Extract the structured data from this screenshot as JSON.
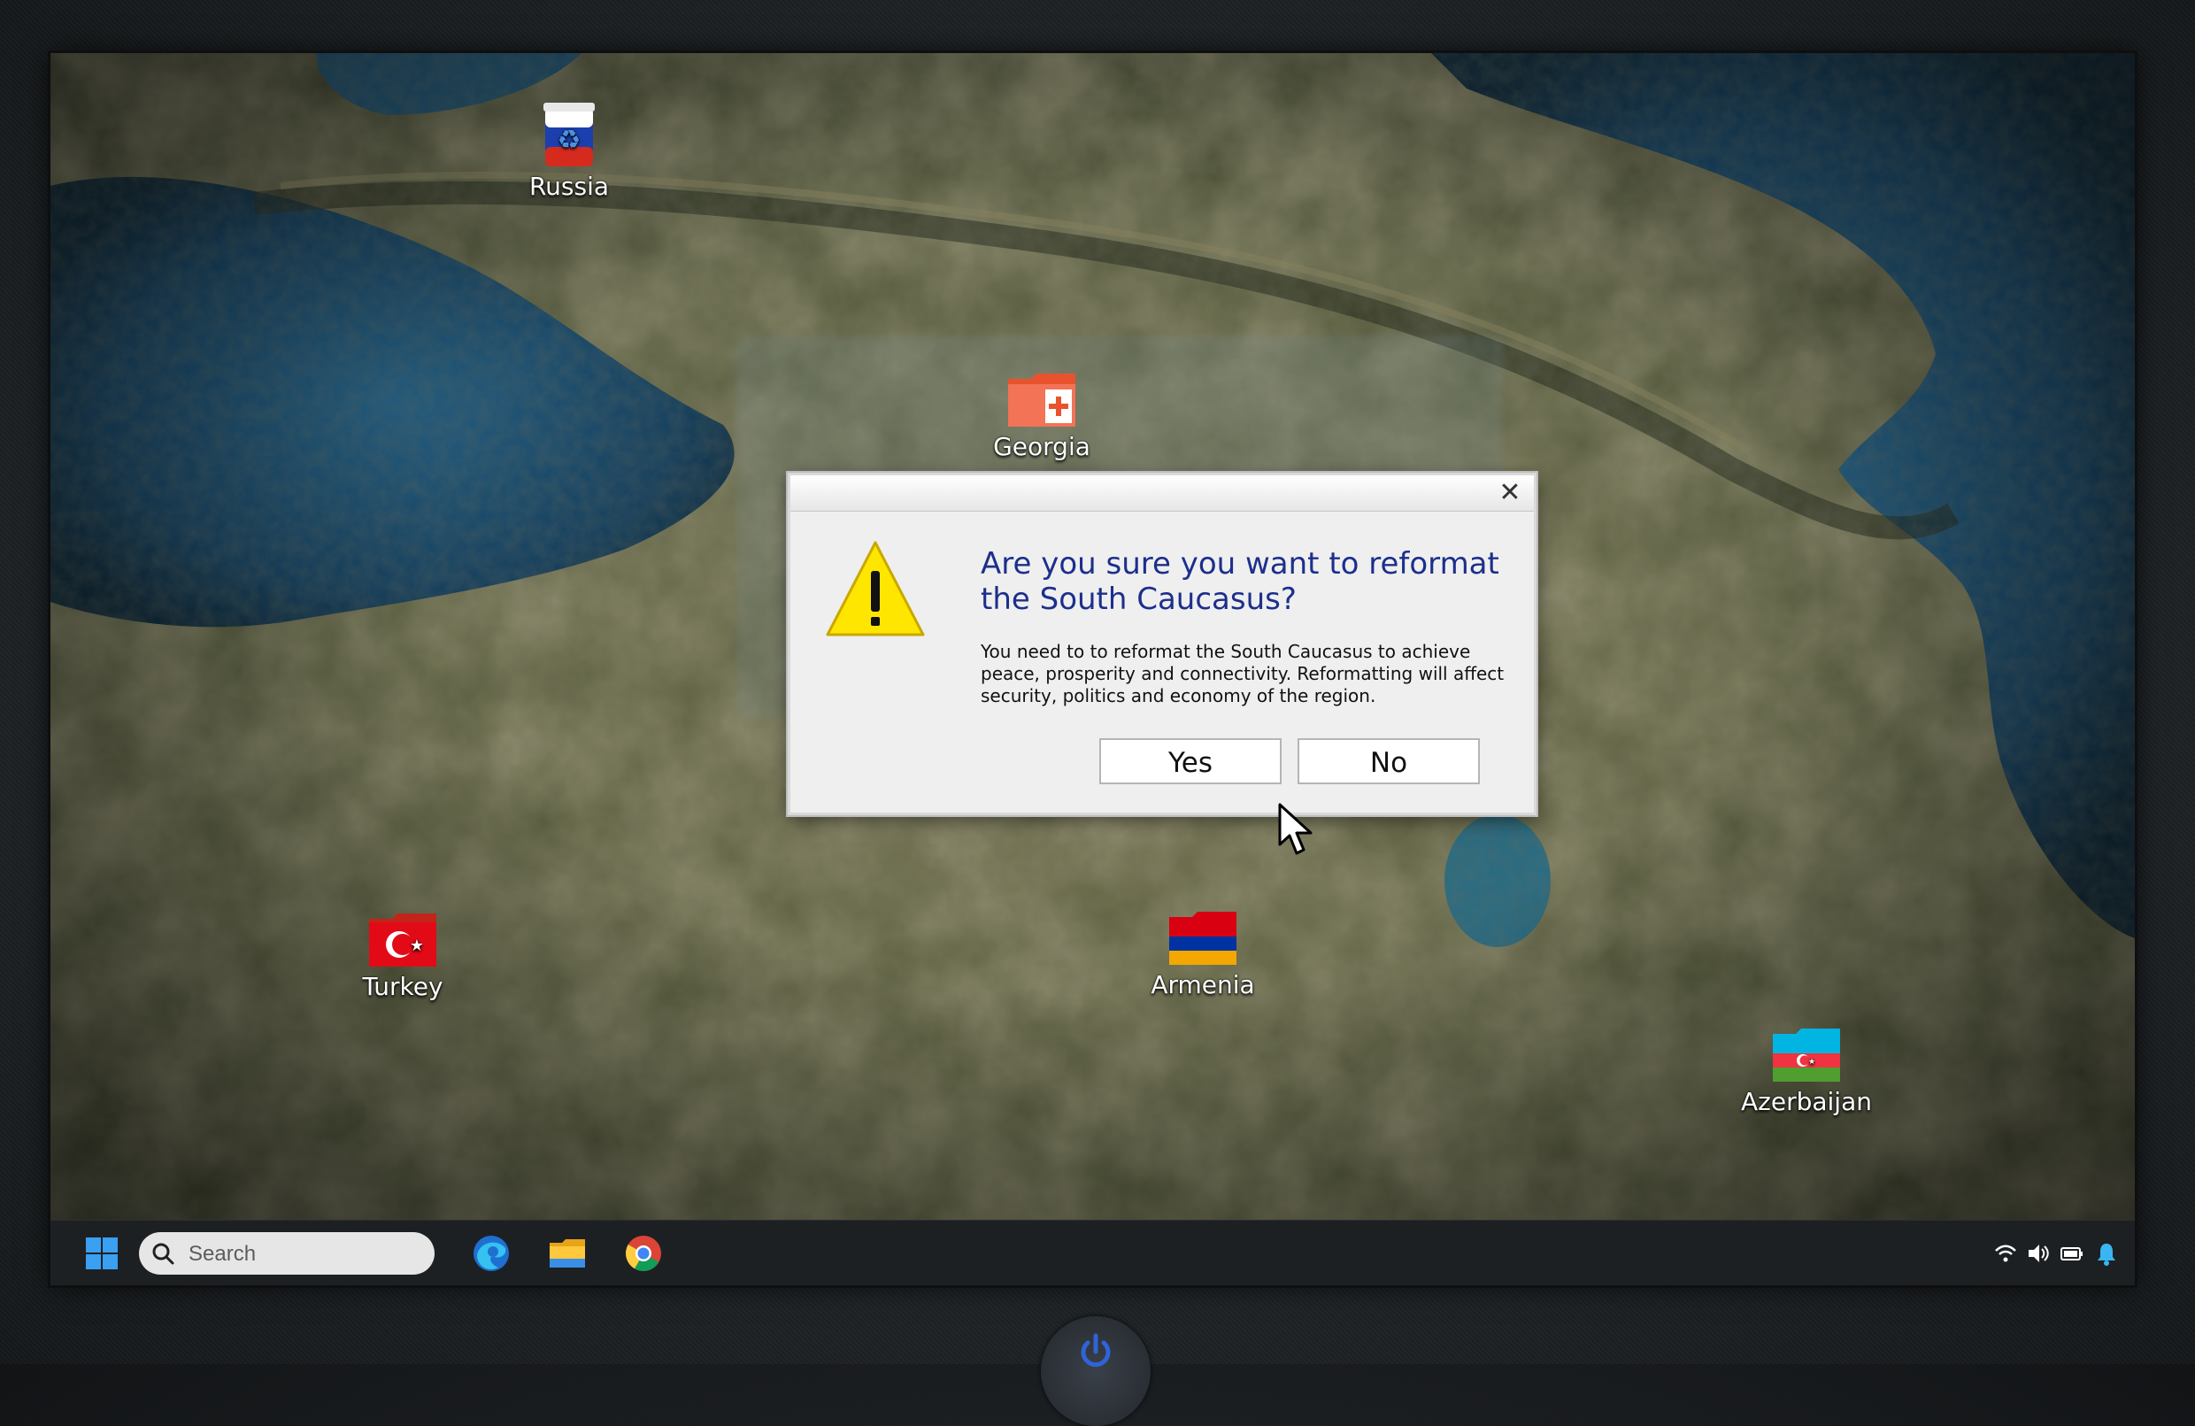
{
  "desktop": {
    "icons": [
      {
        "label": "Russia",
        "icon": "recycle-bin-russia-flag-icon"
      },
      {
        "label": "Georgia",
        "icon": "folder-georgia-flag-icon"
      },
      {
        "label": "Turkey",
        "icon": "folder-turkey-flag-icon"
      },
      {
        "label": "Armenia",
        "icon": "folder-armenia-flag-icon"
      },
      {
        "label": "Azerbaijan",
        "icon": "folder-azerbaijan-flag-icon"
      }
    ]
  },
  "dialog": {
    "icon": "warning-icon",
    "title": "Are you sure you want to reformat the South Caucasus?",
    "body": "You need to to reformat the South Caucasus to achieve peace, prosperity and connectivity. Reformatting will affect security, politics and economy of the region.",
    "yes_label": "Yes",
    "no_label": "No",
    "close_symbol": "✕"
  },
  "taskbar": {
    "start_icon": "windows-start-icon",
    "search_placeholder": "Search",
    "apps": [
      "edge-browser-icon",
      "file-explorer-icon",
      "chrome-browser-icon"
    ],
    "tray": [
      "wifi-icon",
      "volume-icon",
      "battery-icon",
      "notification-bell-icon"
    ]
  },
  "colors": {
    "dialog_title": "#1c2f8c",
    "taskbar_bg": "#1d2023",
    "warning_yellow": "#ffe600"
  }
}
